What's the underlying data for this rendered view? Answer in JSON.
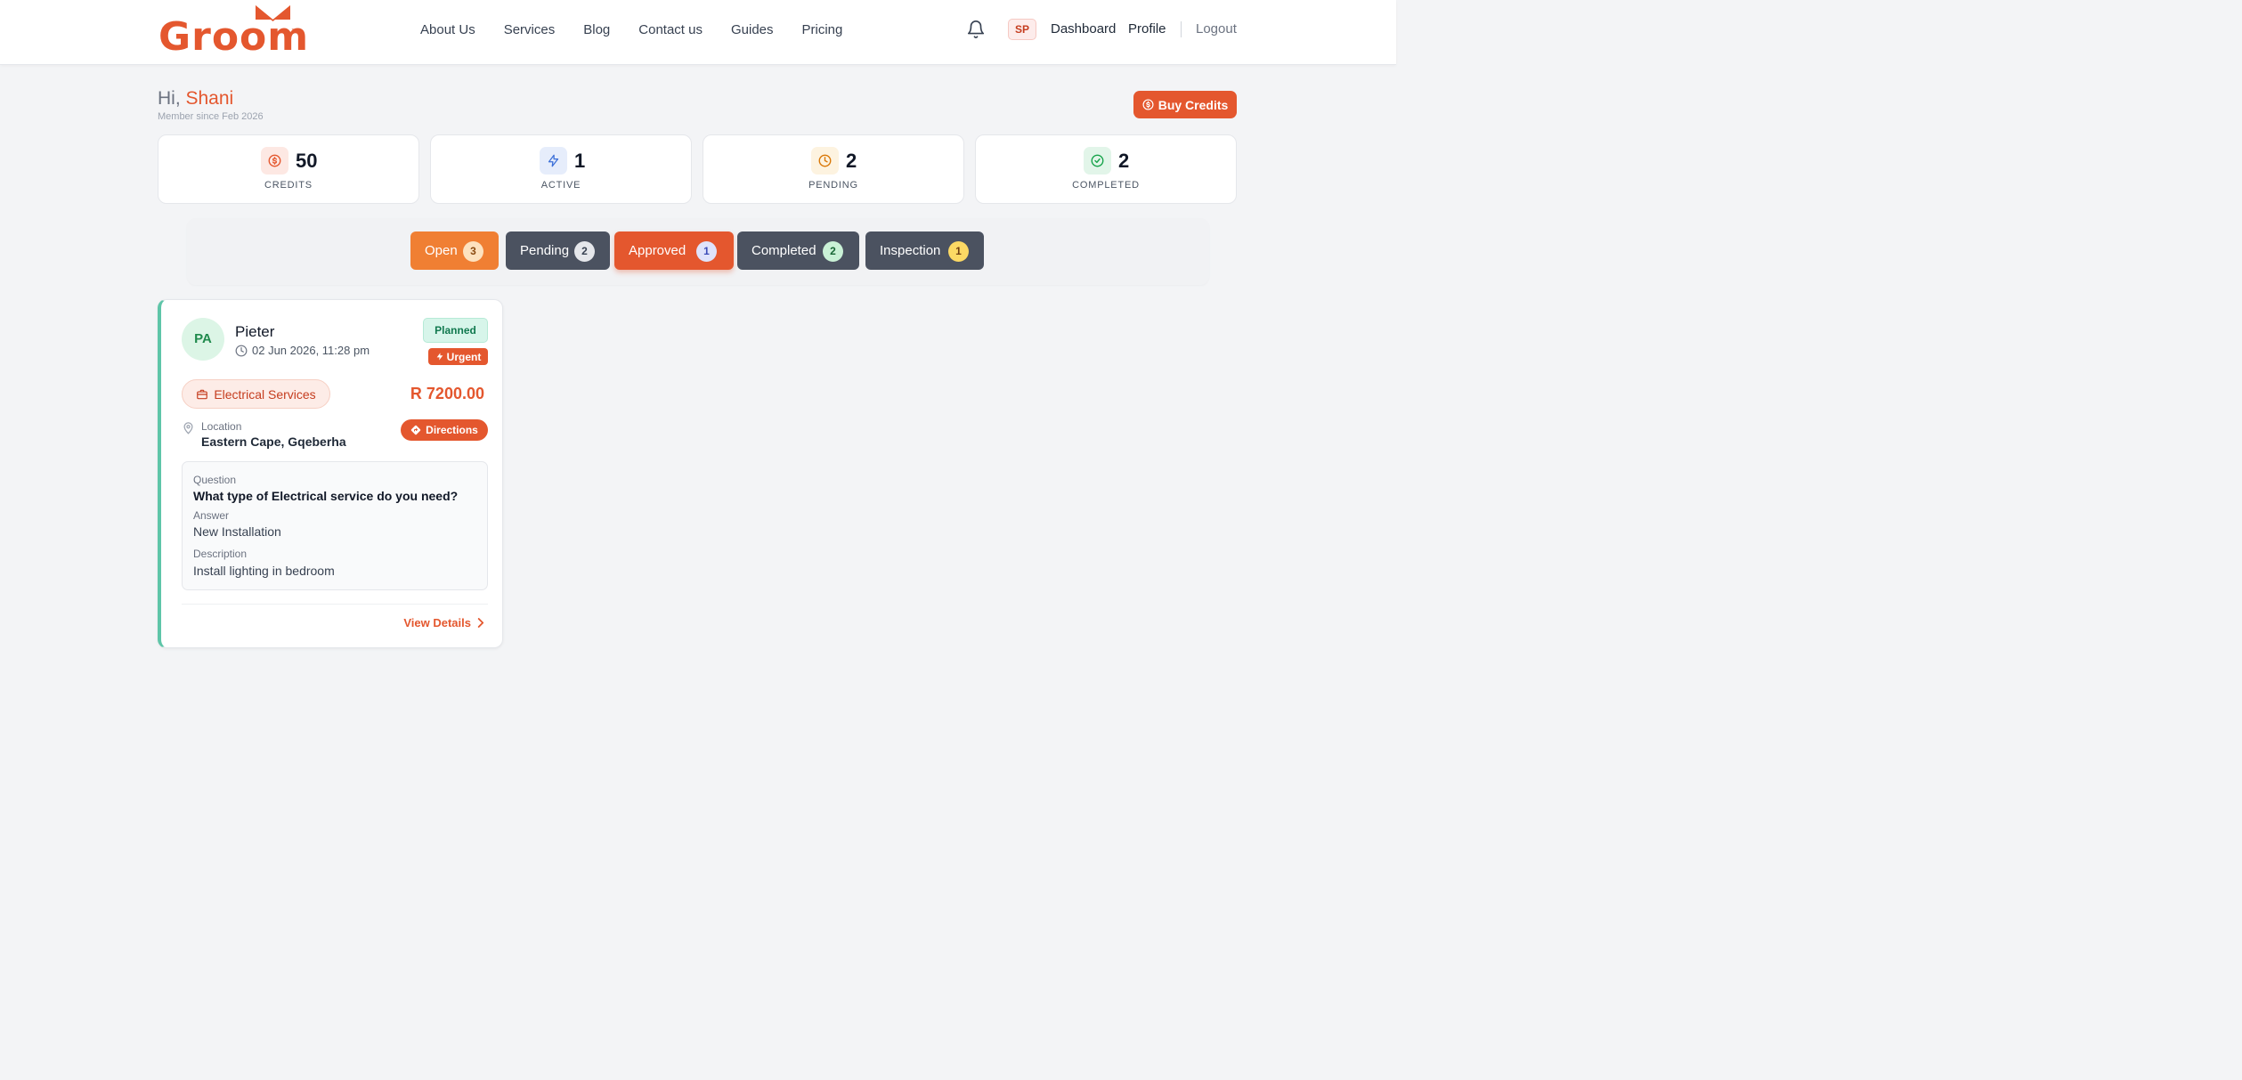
{
  "header": {
    "logo_text": "Groom",
    "logo_tm": "™",
    "nav": [
      "About Us",
      "Services",
      "Blog",
      "Contact us",
      "Guides",
      "Pricing"
    ],
    "user_initials": "SP",
    "dashboard_label": "Dashboard",
    "profile_label": "Profile",
    "logout_label": "Logout"
  },
  "greeting": {
    "prefix": "Hi, ",
    "name": "Shani",
    "member_since": "Member since Feb 2026",
    "buy_credits": "Buy Credits"
  },
  "stats": [
    {
      "icon": "dollar-icon",
      "value": "50",
      "label": "CREDITS",
      "color": "#e4572e"
    },
    {
      "icon": "bolt-icon",
      "value": "1",
      "label": "ACTIVE",
      "color": "#3b6fd8"
    },
    {
      "icon": "clock-icon",
      "value": "2",
      "label": "PENDING",
      "color": "#d97706"
    },
    {
      "icon": "check-circle-icon",
      "value": "2",
      "label": "COMPLETED",
      "color": "#16a34a"
    }
  ],
  "tabs": [
    {
      "label": "Open",
      "count": "3",
      "color": "#f07f33"
    },
    {
      "label": "Pending",
      "count": "2",
      "color": "#4b5260"
    },
    {
      "label": "Approved",
      "count": "1",
      "color": "#e4572e"
    },
    {
      "label": "Completed",
      "count": "2",
      "color": "#4b5260"
    },
    {
      "label": "Inspection",
      "count": "1",
      "color": "#4b5260"
    }
  ],
  "job": {
    "initials": "PA",
    "name": "Pieter",
    "date": "02 Jun 2026, 11:28 pm",
    "status": "Planned",
    "priority": "Urgent",
    "service": "Electrical Services",
    "price": "R 7200.00",
    "location_label": "Location",
    "location": "Eastern Cape, Gqeberha",
    "directions": "Directions",
    "question_label": "Question",
    "question": "What type of Electrical service do you need?",
    "answer_label": "Answer",
    "answer": "New Installation",
    "description_label": "Description",
    "description": "Install lighting in bedroom",
    "view_details": "View Details"
  },
  "colors": {
    "brand": "#e4572e",
    "accent_border": "#5ec5a8"
  }
}
